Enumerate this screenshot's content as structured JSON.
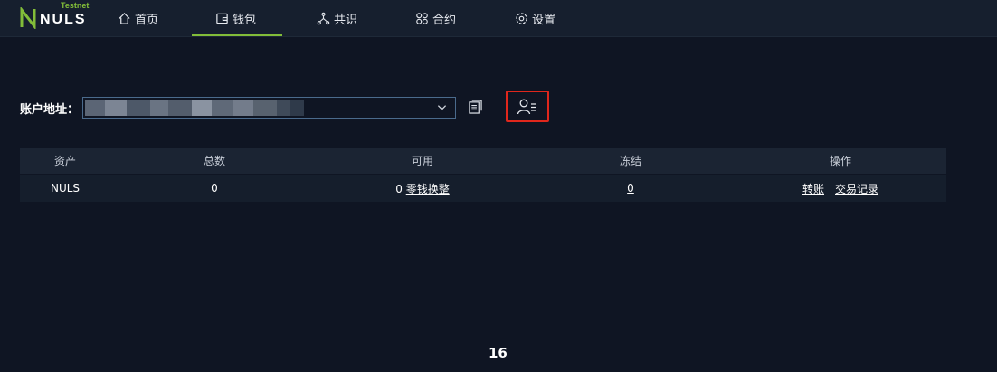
{
  "brand": {
    "name": "NULS",
    "badge": "Testnet",
    "accent": "#82bd39"
  },
  "nav": {
    "items": [
      {
        "label": "首页",
        "icon": "home-icon"
      },
      {
        "label": "钱包",
        "icon": "wallet-icon",
        "active": true
      },
      {
        "label": "共识",
        "icon": "consensus-icon"
      },
      {
        "label": "合约",
        "icon": "contract-icon"
      },
      {
        "label": "设置",
        "icon": "settings-icon"
      }
    ]
  },
  "account": {
    "label": "账户地址：",
    "address_value_blurred": true
  },
  "table": {
    "headers": [
      "资产",
      "总数",
      "可用",
      "冻结",
      "操作"
    ],
    "rows": [
      {
        "asset": "NULS",
        "total": "0",
        "available": "0",
        "available_link": "零钱换整",
        "frozen": "0",
        "action_transfer": "转账",
        "action_records": "交易记录"
      }
    ]
  },
  "footer": {
    "page_number": "16"
  },
  "colors": {
    "highlight_border": "#e0271c",
    "background": "#0f1523",
    "topbar": "#161f2e"
  }
}
